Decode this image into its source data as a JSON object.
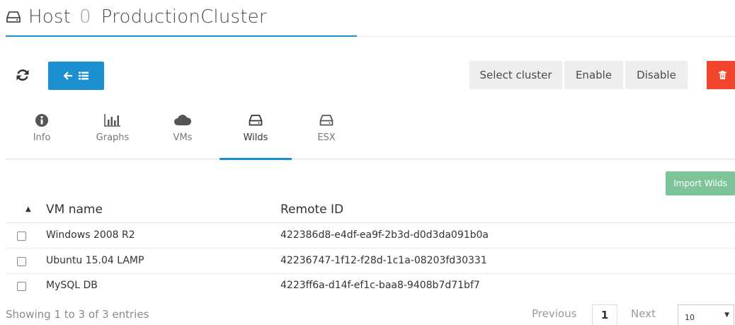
{
  "header": {
    "title": "Host",
    "number": "0",
    "name": "ProductionCluster",
    "icon": "hard-drive-icon"
  },
  "toolbar": {
    "refresh_icon": "refresh-icon",
    "back_icons": [
      "arrow-left-icon",
      "list-icon"
    ],
    "buttons": [
      "Select cluster",
      "Enable",
      "Disable"
    ],
    "delete_icon": "trash-icon",
    "colors": {
      "primary": "#1b8fd0",
      "danger": "#f1452e",
      "success": "#7ec49a"
    }
  },
  "tabs": [
    {
      "label": "Info",
      "icon": "info-circle-icon"
    },
    {
      "label": "Graphs",
      "icon": "bar-chart-icon"
    },
    {
      "label": "VMs",
      "icon": "cloud-icon"
    },
    {
      "label": "Wilds",
      "icon": "hard-drive-icon",
      "active": true
    },
    {
      "label": "ESX",
      "icon": "hard-drive-icon"
    }
  ],
  "import_button": "Import Wilds",
  "table": {
    "columns": [
      "VM name",
      "Remote ID"
    ],
    "rows": [
      {
        "name": "Windows 2008 R2",
        "remote_id": "422386d8-e4df-ea9f-2b3d-d0d3da091b0a"
      },
      {
        "name": "Ubuntu 15.04 LAMP",
        "remote_id": "42236747-1f12-f28d-1c1a-08203fd30331"
      },
      {
        "name": "MySQL DB",
        "remote_id": "4223ff6a-d14f-ef1c-baa8-9408b7d71bf7"
      }
    ]
  },
  "footer": {
    "showing": "Showing 1 to 3 of 3 entries",
    "previous": "Previous",
    "page": "1",
    "next": "Next",
    "page_size": "10"
  }
}
